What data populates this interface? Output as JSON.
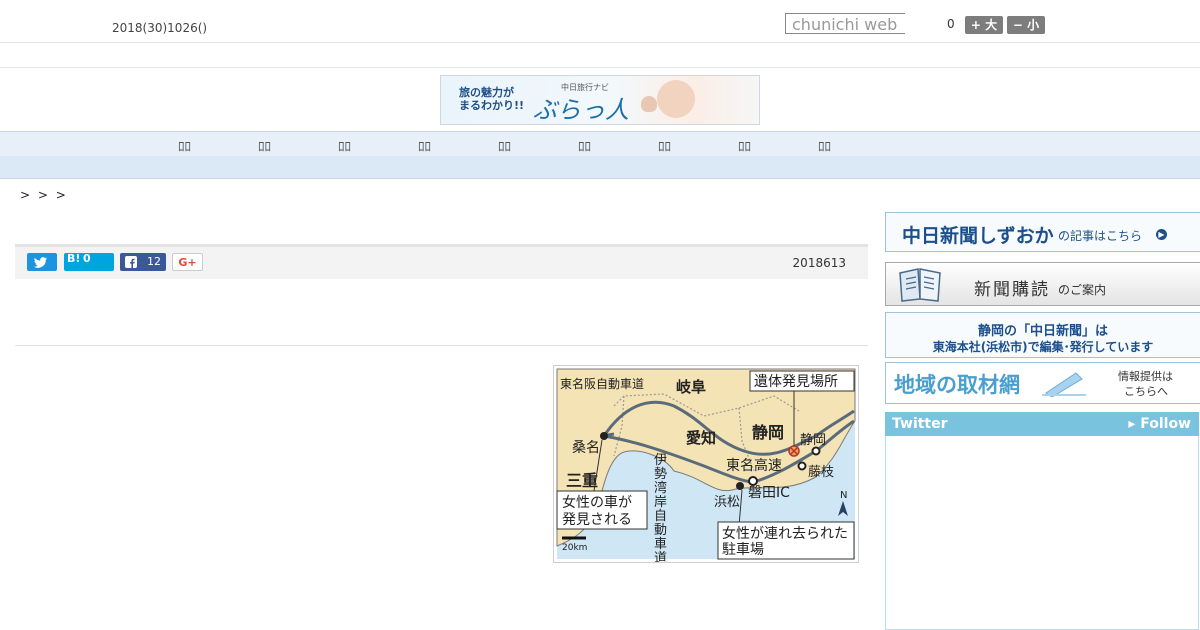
{
  "header": {
    "date": "2018(30)1026()",
    "search_placeholder": "chunichi web",
    "count": "0",
    "font_larger_label": "+ 大",
    "font_smaller_label": "− 小"
  },
  "banner": {
    "tagline_line1": "旅の魅力が",
    "tagline_line2": "まるわかり!!",
    "small_label": "中日旅行ナビ",
    "brand": "ぶらっ人"
  },
  "nav": {
    "items": [
      "ﾛﾛ",
      "ﾛﾛ",
      "ﾛﾛ",
      "ﾛﾛ",
      "ﾛﾛ",
      "ﾛﾛ",
      "ﾛﾛ",
      "ﾛﾛ",
      "ﾛﾛ"
    ]
  },
  "breadcrumb": {
    "text": "> > >"
  },
  "share": {
    "hatena_label": "B!",
    "hatena_count": "0",
    "facebook_count": "12",
    "gplus_label": "G+",
    "date": "2018613"
  },
  "map": {
    "labels": {
      "tomei_han": "東名阪自動車道",
      "gifu": "岐阜",
      "body_found": "遺体発見場所",
      "aichi": "愛知",
      "shizuoka_pref": "静岡",
      "shizuoka_city": "静岡",
      "kuwana": "桑名",
      "mie": "三重",
      "isewan_vertical": "伊勢湾岸自動車道",
      "tomei": "東名高速",
      "fujieda": "藤枝",
      "iwata_ic": "磐田IC",
      "hamamatsu": "浜松",
      "car_found_line1": "女性の車が",
      "car_found_line2": "発見される",
      "taken_line1": "女性が連れ去られた",
      "taken_line2": "駐車場",
      "scale": "20km",
      "north": "N"
    },
    "colors": {
      "land": "#f4e3b5",
      "sea": "#cfe6f5",
      "road": "#5a6b7a"
    }
  },
  "sidebar": {
    "box1_main": "中日新聞しずおか",
    "box1_tail": "の記事はこちら",
    "box2_main": "新聞購読",
    "box2_tail": "のご案内",
    "box3_line1": "静岡の「中日新聞」は",
    "box3_line2": "東海本社(浜松市)で編集･発行しています",
    "box4_main": "地域の取材網",
    "box4_tail1": "情報提供は",
    "box4_tail2": "こちらへ",
    "twitter_label": "Twitter",
    "follow_label": "▸ Follow"
  }
}
